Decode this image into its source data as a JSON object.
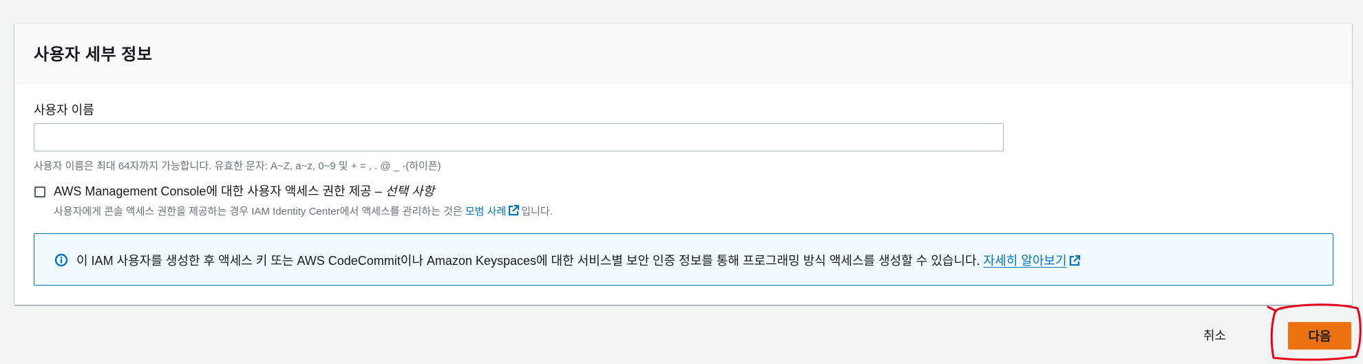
{
  "panel": {
    "title": "사용자 세부 정보"
  },
  "username": {
    "label": "사용자 이름",
    "value": "",
    "placeholder": "",
    "hint": "사용자 이름은 최대 64자까지 가능합니다. 유효한 문자: A~Z, a~z, 0~9 및 + = , . @ _ -(하이픈)"
  },
  "console_access": {
    "checked": false,
    "label": "AWS Management Console에 대한 사용자 액세스 권한 제공 –",
    "optional": "선택 사항",
    "desc_prefix": "사용자에게 콘솔 액세스 권한을 제공하는 경우 IAM Identity Center에서 액세스를 관리하는 것은",
    "desc_link": "모범 사례",
    "desc_suffix": "입니다."
  },
  "info_alert": {
    "text": "이 IAM 사용자를 생성한 후 액세스 키 또는 AWS CodeCommit이나 Amazon Keyspaces에 대한 서비스별 보안 인증 정보를 통해 프로그래밍 방식 액세스를 생성할 수 있습니다.",
    "link": "자세히 알아보기"
  },
  "footer": {
    "cancel_label": "취소",
    "next_label": "다음"
  },
  "colors": {
    "link": "#0073bb",
    "primary_button": "#ec7211",
    "info_border": "#0073bb",
    "info_background": "#f1faff",
    "annotation": "#e8001c"
  },
  "icons": [
    "info-icon",
    "external-link-icon"
  ]
}
